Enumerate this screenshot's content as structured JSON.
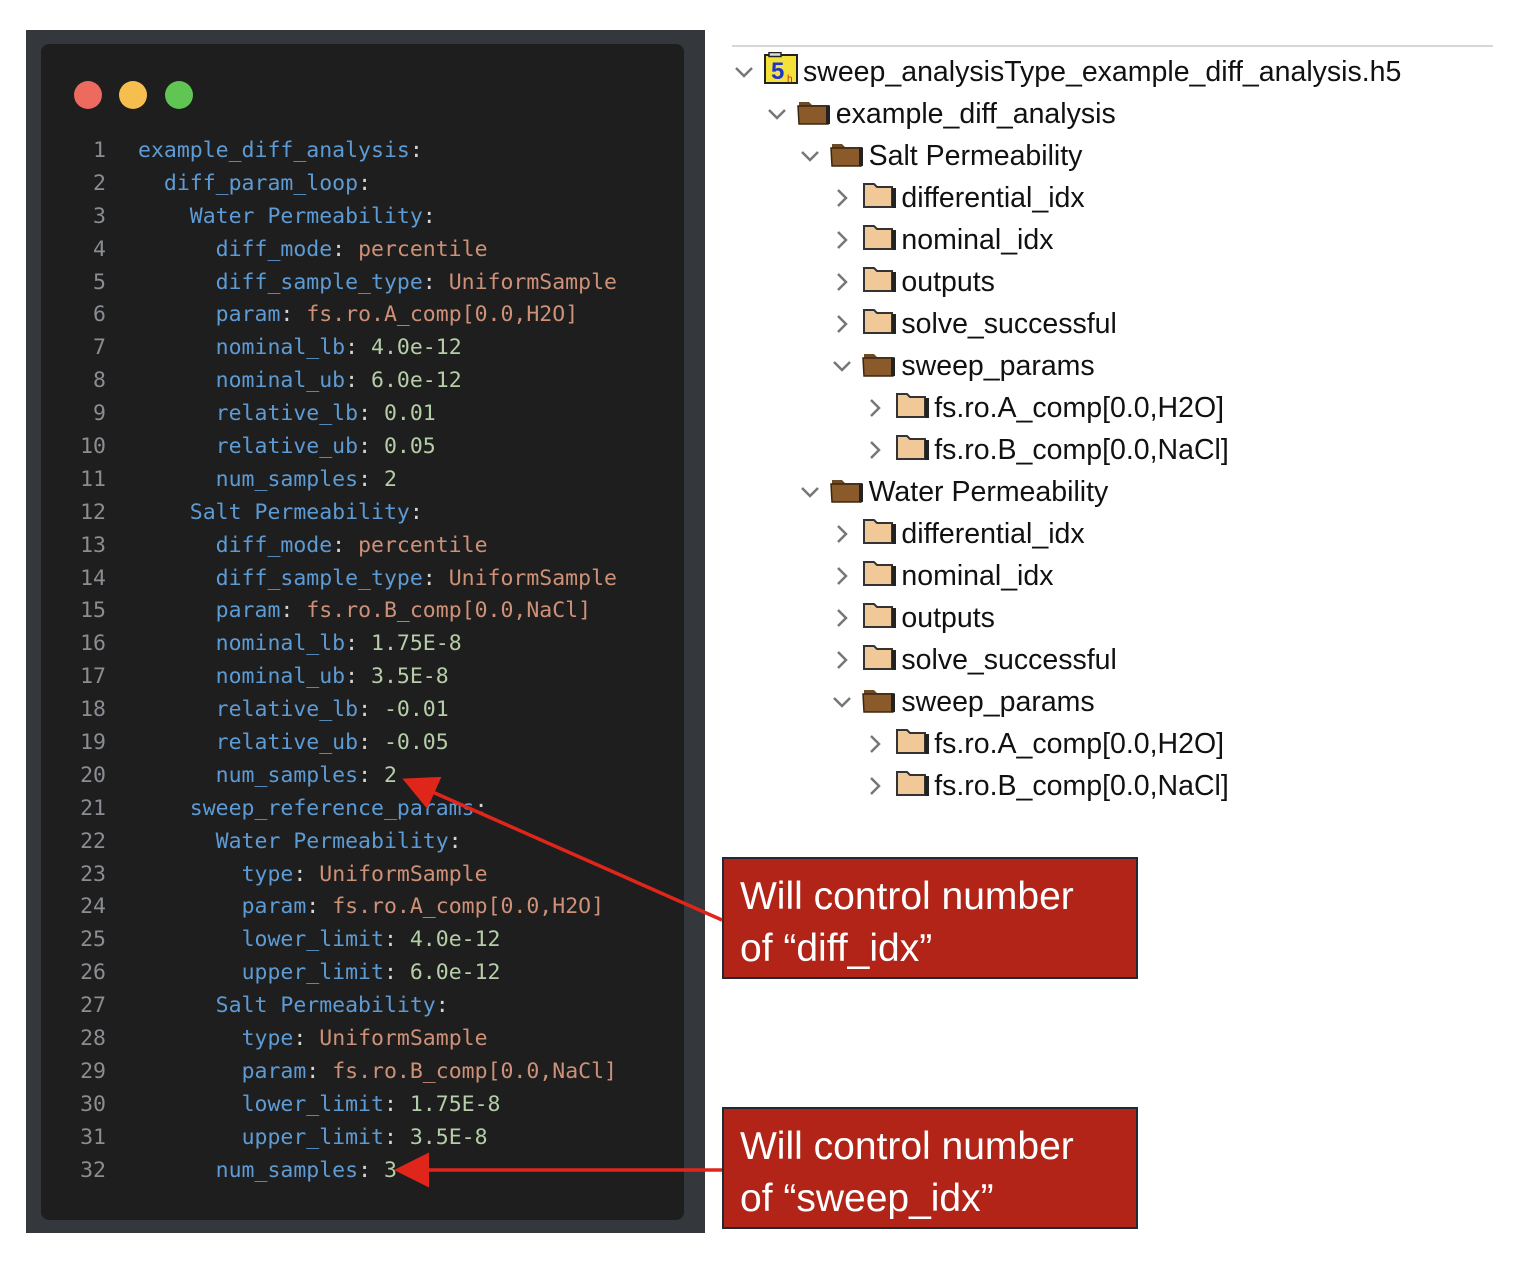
{
  "window_controls": {
    "close_color": "#ed6a5e",
    "minimize_color": "#f5be4f",
    "zoom_color": "#61c554"
  },
  "code": {
    "lines": [
      {
        "n": "1",
        "indent": 0,
        "key": "example_diff_analysis",
        "value": "",
        "type": ""
      },
      {
        "n": "2",
        "indent": 1,
        "key": "diff_param_loop",
        "value": "",
        "type": ""
      },
      {
        "n": "3",
        "indent": 2,
        "key": "Water Permeability",
        "value": "",
        "type": ""
      },
      {
        "n": "4",
        "indent": 3,
        "key": "diff_mode",
        "value": "percentile",
        "type": "s"
      },
      {
        "n": "5",
        "indent": 3,
        "key": "diff_sample_type",
        "value": "UniformSample",
        "type": "s"
      },
      {
        "n": "6",
        "indent": 3,
        "key": "param",
        "value": "fs.ro.A_comp[0.0,H2O]",
        "type": "s"
      },
      {
        "n": "7",
        "indent": 3,
        "key": "nominal_lb",
        "value": "4.0e-12",
        "type": "n"
      },
      {
        "n": "8",
        "indent": 3,
        "key": "nominal_ub",
        "value": "6.0e-12",
        "type": "n"
      },
      {
        "n": "9",
        "indent": 3,
        "key": "relative_lb",
        "value": "0.01",
        "type": "n"
      },
      {
        "n": "10",
        "indent": 3,
        "key": "relative_ub",
        "value": "0.05",
        "type": "n"
      },
      {
        "n": "11",
        "indent": 3,
        "key": "num_samples",
        "value": "2",
        "type": "n"
      },
      {
        "n": "12",
        "indent": 2,
        "key": "Salt Permeability",
        "value": "",
        "type": ""
      },
      {
        "n": "13",
        "indent": 3,
        "key": "diff_mode",
        "value": "percentile",
        "type": "s"
      },
      {
        "n": "14",
        "indent": 3,
        "key": "diff_sample_type",
        "value": "UniformSample",
        "type": "s"
      },
      {
        "n": "15",
        "indent": 3,
        "key": "param",
        "value": "fs.ro.B_comp[0.0,NaCl]",
        "type": "s"
      },
      {
        "n": "16",
        "indent": 3,
        "key": "nominal_lb",
        "value": "1.75E-8",
        "type": "n"
      },
      {
        "n": "17",
        "indent": 3,
        "key": "nominal_ub",
        "value": "3.5E-8",
        "type": "n"
      },
      {
        "n": "18",
        "indent": 3,
        "key": "relative_lb",
        "value": "-0.01",
        "type": "n"
      },
      {
        "n": "19",
        "indent": 3,
        "key": "relative_ub",
        "value": "-0.05",
        "type": "n"
      },
      {
        "n": "20",
        "indent": 3,
        "key": "num_samples",
        "value": "2",
        "type": "n"
      },
      {
        "n": "21",
        "indent": 2,
        "key": "sweep_reference_params",
        "value": "",
        "type": ""
      },
      {
        "n": "22",
        "indent": 3,
        "key": "Water Permeability",
        "value": "",
        "type": ""
      },
      {
        "n": "23",
        "indent": 4,
        "key": "type",
        "value": "UniformSample",
        "type": "s"
      },
      {
        "n": "24",
        "indent": 4,
        "key": "param",
        "value": "fs.ro.A_comp[0.0,H2O]",
        "type": "s"
      },
      {
        "n": "25",
        "indent": 4,
        "key": "lower_limit",
        "value": "4.0e-12",
        "type": "n"
      },
      {
        "n": "26",
        "indent": 4,
        "key": "upper_limit",
        "value": "6.0e-12",
        "type": "n"
      },
      {
        "n": "27",
        "indent": 3,
        "key": "Salt Permeability",
        "value": "",
        "type": ""
      },
      {
        "n": "28",
        "indent": 4,
        "key": "type",
        "value": "UniformSample",
        "type": "s"
      },
      {
        "n": "29",
        "indent": 4,
        "key": "param",
        "value": "fs.ro.B_comp[0.0,NaCl]",
        "type": "s"
      },
      {
        "n": "30",
        "indent": 4,
        "key": "lower_limit",
        "value": "1.75E-8",
        "type": "n"
      },
      {
        "n": "31",
        "indent": 4,
        "key": "upper_limit",
        "value": "3.5E-8",
        "type": "n"
      },
      {
        "n": "32",
        "indent": 3,
        "key": "num_samples",
        "value": "3",
        "type": "n"
      }
    ]
  },
  "tree": {
    "nodes": [
      {
        "level": 0,
        "label": "sweep_analysisType_example_diff_analysis.h5",
        "expanded": true,
        "icon": "hdf5-file-icon"
      },
      {
        "level": 1,
        "label": "example_diff_analysis",
        "expanded": true,
        "icon": "folder-open-icon"
      },
      {
        "level": 2,
        "label": "Salt Permeability",
        "expanded": true,
        "icon": "folder-open-icon"
      },
      {
        "level": 3,
        "label": "differential_idx",
        "expanded": false,
        "icon": "folder-icon"
      },
      {
        "level": 3,
        "label": "nominal_idx",
        "expanded": false,
        "icon": "folder-icon"
      },
      {
        "level": 3,
        "label": "outputs",
        "expanded": false,
        "icon": "folder-icon"
      },
      {
        "level": 3,
        "label": "solve_successful",
        "expanded": false,
        "icon": "folder-icon"
      },
      {
        "level": 3,
        "label": "sweep_params",
        "expanded": true,
        "icon": "folder-open-icon"
      },
      {
        "level": 4,
        "label": "fs.ro.A_comp[0.0,H2O]",
        "expanded": false,
        "icon": "folder-icon"
      },
      {
        "level": 4,
        "label": "fs.ro.B_comp[0.0,NaCl]",
        "expanded": false,
        "icon": "folder-icon"
      },
      {
        "level": 2,
        "label": "Water Permeability",
        "expanded": true,
        "icon": "folder-open-icon"
      },
      {
        "level": 3,
        "label": "differential_idx",
        "expanded": false,
        "icon": "folder-icon"
      },
      {
        "level": 3,
        "label": "nominal_idx",
        "expanded": false,
        "icon": "folder-icon"
      },
      {
        "level": 3,
        "label": "outputs",
        "expanded": false,
        "icon": "folder-icon"
      },
      {
        "level": 3,
        "label": "solve_successful",
        "expanded": false,
        "icon": "folder-icon"
      },
      {
        "level": 3,
        "label": "sweep_params",
        "expanded": true,
        "icon": "folder-open-icon"
      },
      {
        "level": 4,
        "label": "fs.ro.A_comp[0.0,H2O]",
        "expanded": false,
        "icon": "folder-icon"
      },
      {
        "level": 4,
        "label": "fs.ro.B_comp[0.0,NaCl]",
        "expanded": false,
        "icon": "folder-icon"
      }
    ]
  },
  "annotations": [
    {
      "line1": "Will control number",
      "line2": "of “diff_idx”",
      "points_to_line": "20"
    },
    {
      "line1": "Will control number",
      "line2": "of “sweep_idx”",
      "points_to_line": "32"
    }
  ],
  "colors": {
    "annotation_bg": "#b22417",
    "arrow": "#e0261b",
    "key": "#5d9bd5",
    "string": "#ce9178",
    "number": "#b5cea8"
  }
}
